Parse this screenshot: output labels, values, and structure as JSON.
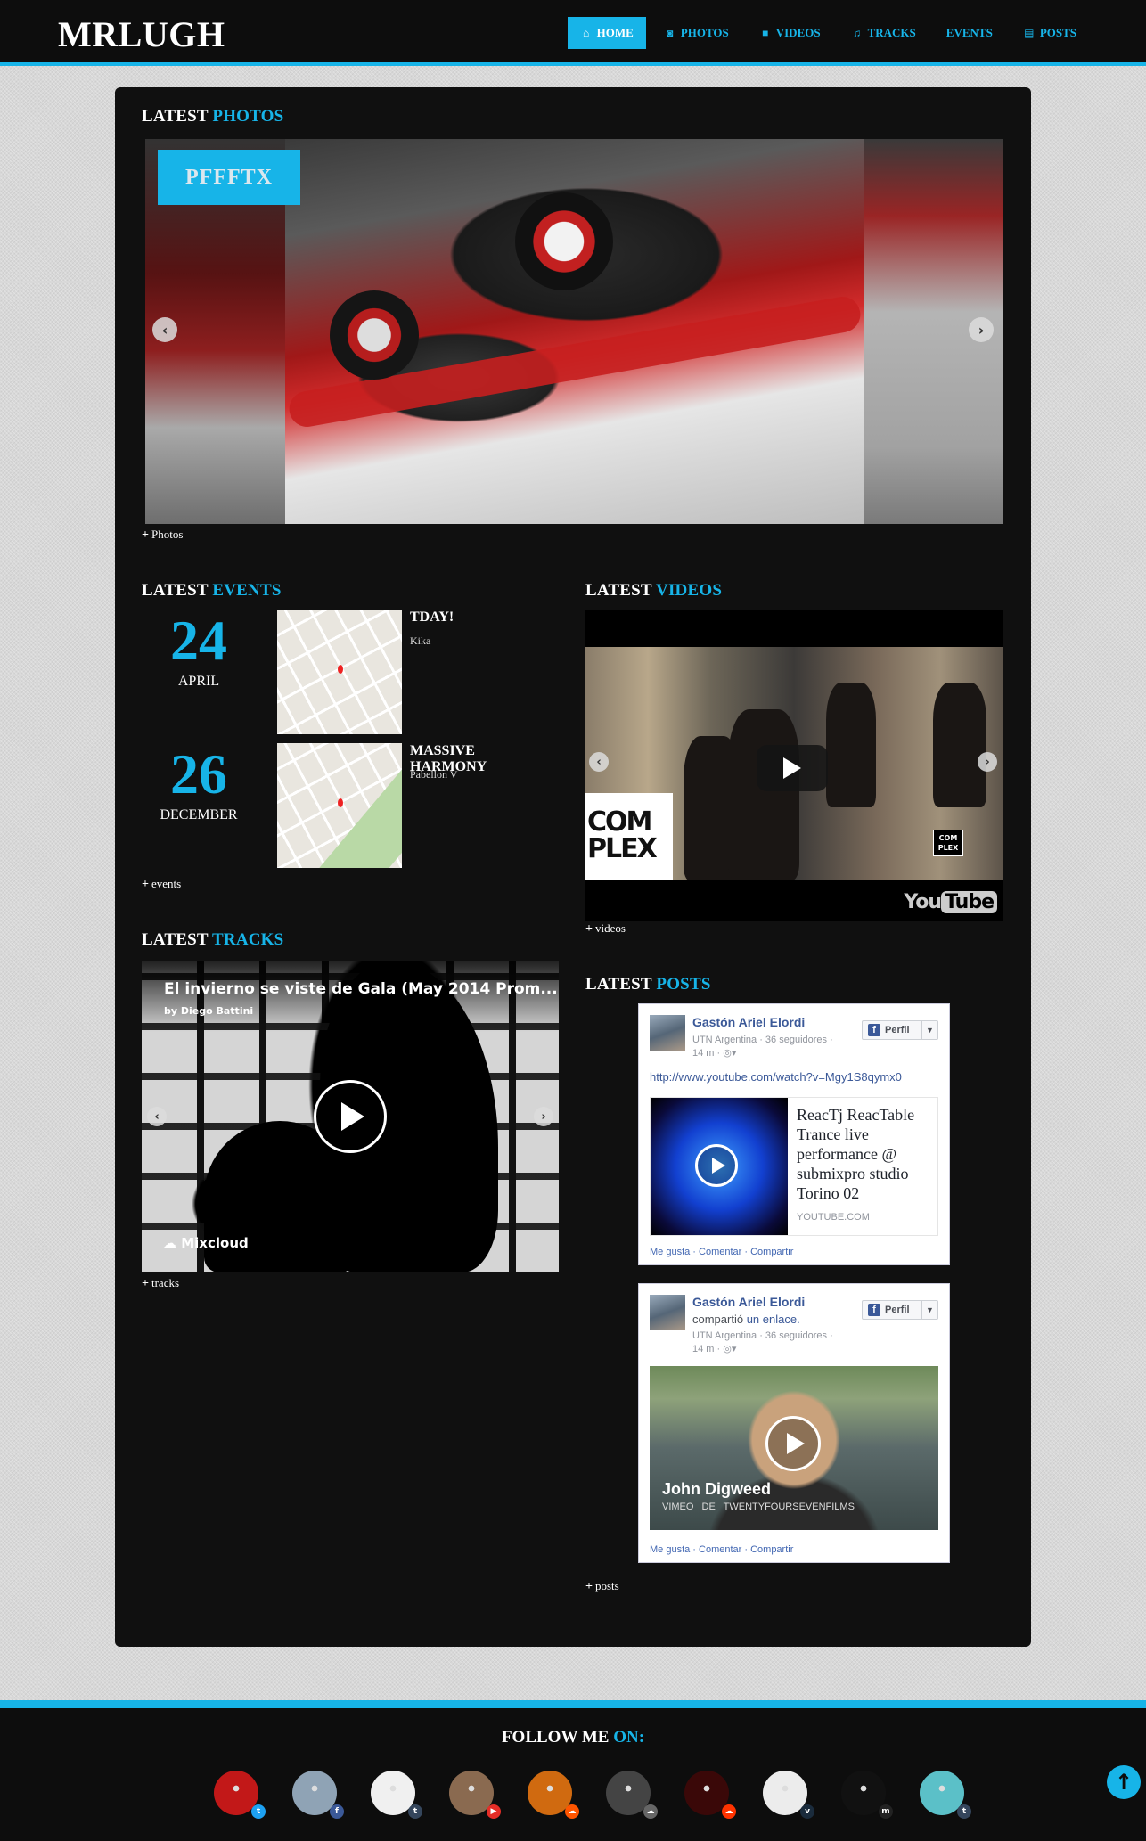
{
  "brand": "MRLUGH",
  "nav": [
    {
      "label": "HOME",
      "icon": "home-icon",
      "glyph": "⌂",
      "active": true
    },
    {
      "label": "PHOTOS",
      "icon": "camera-icon",
      "glyph": "◙",
      "active": false
    },
    {
      "label": "VIDEOS",
      "icon": "video-camera-icon",
      "glyph": "■",
      "active": false
    },
    {
      "label": "TRACKS",
      "icon": "music-icon",
      "glyph": "♫",
      "active": false
    },
    {
      "label": "EVENTS",
      "icon": "",
      "glyph": "",
      "active": false
    },
    {
      "label": "POSTS",
      "icon": "document-icon",
      "glyph": "▤",
      "active": false
    }
  ],
  "photos": {
    "title_a": "LATEST ",
    "title_b": "PHOTOS",
    "caption": "PFFFTX",
    "more": "Photos"
  },
  "events": {
    "title_a": "LATEST ",
    "title_b": "EVENTS",
    "items": [
      {
        "day": "24",
        "month": "APRIL",
        "name": "TDAY!",
        "place": "Kika"
      },
      {
        "day": "26",
        "month": "DECEMBER",
        "name": "MASSIVE HARMONY",
        "place": "Pabellon V"
      }
    ],
    "more": "events"
  },
  "tracks": {
    "title_a": "LATEST ",
    "title_b": "TRACKS",
    "track_title": "El invierno se viste de Gala (May 2014 Prom...",
    "track_author": "by Diego Battini",
    "provider": "Mixcloud",
    "more": "tracks"
  },
  "videos": {
    "title_a": "LATEST ",
    "title_b": "VIDEOS",
    "overlay_brand": "COM PLEX",
    "overlay_small": "COM PLEX",
    "youtube_a": "You",
    "youtube_b": "Tube",
    "more": "videos"
  },
  "posts": {
    "title_a": "LATEST ",
    "title_b": "POSTS",
    "items": [
      {
        "author": "Gastón Ariel Elordi",
        "meta1": "UTN Argentina · 36 seguidores ·",
        "meta2": "14 m · ◎▾",
        "button": "Perfil",
        "url": "http://www.youtube.com/watch?v=Mgy1S8qymx0",
        "card_title": "ReacTj ReacTable Trance live performance @ submixpro studio Torino 02",
        "card_domain": "YOUTUBE.COM",
        "actions": "Me gusta · Comentar · Compartir"
      },
      {
        "author": "Gastón Ariel Elordi",
        "action_a": "compartió ",
        "action_b": "un enlace.",
        "meta1": "UTN Argentina · 36 seguidores ·",
        "meta2": "14 m · ◎▾",
        "button": "Perfil",
        "video_title": "John Digweed",
        "video_sub": "VIMEO  DE TWENTYFOURSEVENFILMS",
        "actions": "Me gusta · Comentar · Compartir"
      }
    ],
    "more": "posts"
  },
  "footer": {
    "title_a": "FOLLOW ME ",
    "title_b": "ON:",
    "socials": [
      {
        "network": "twitter",
        "badge": "t",
        "color": "#1da1f2",
        "avatar": "#c21818"
      },
      {
        "network": "facebook",
        "badge": "f",
        "color": "#3b5998",
        "avatar": "#8fa3b5"
      },
      {
        "network": "tumblr",
        "badge": "t",
        "color": "#35465c",
        "avatar": "#f0f0f0"
      },
      {
        "network": "youtube",
        "badge": "▶",
        "color": "#e52d27",
        "avatar": "#8a6a50"
      },
      {
        "network": "soundcloud",
        "badge": "☁",
        "color": "#ff5500",
        "avatar": "#d06a10"
      },
      {
        "network": "soundcloud",
        "badge": "☁",
        "color": "#666666",
        "avatar": "#444444"
      },
      {
        "network": "soundcloud",
        "badge": "☁",
        "color": "#ff3300",
        "avatar": "#3a0808"
      },
      {
        "network": "vimeo",
        "badge": "v",
        "color": "#1a2b3c",
        "avatar": "#ececec"
      },
      {
        "network": "mixcloud",
        "badge": "m",
        "color": "#222222",
        "avatar": "#111111"
      },
      {
        "network": "tumblr",
        "badge": "t",
        "color": "#35465c",
        "avatar": "#5bc0c8"
      }
    ]
  },
  "accent_color": "#17b4e8"
}
